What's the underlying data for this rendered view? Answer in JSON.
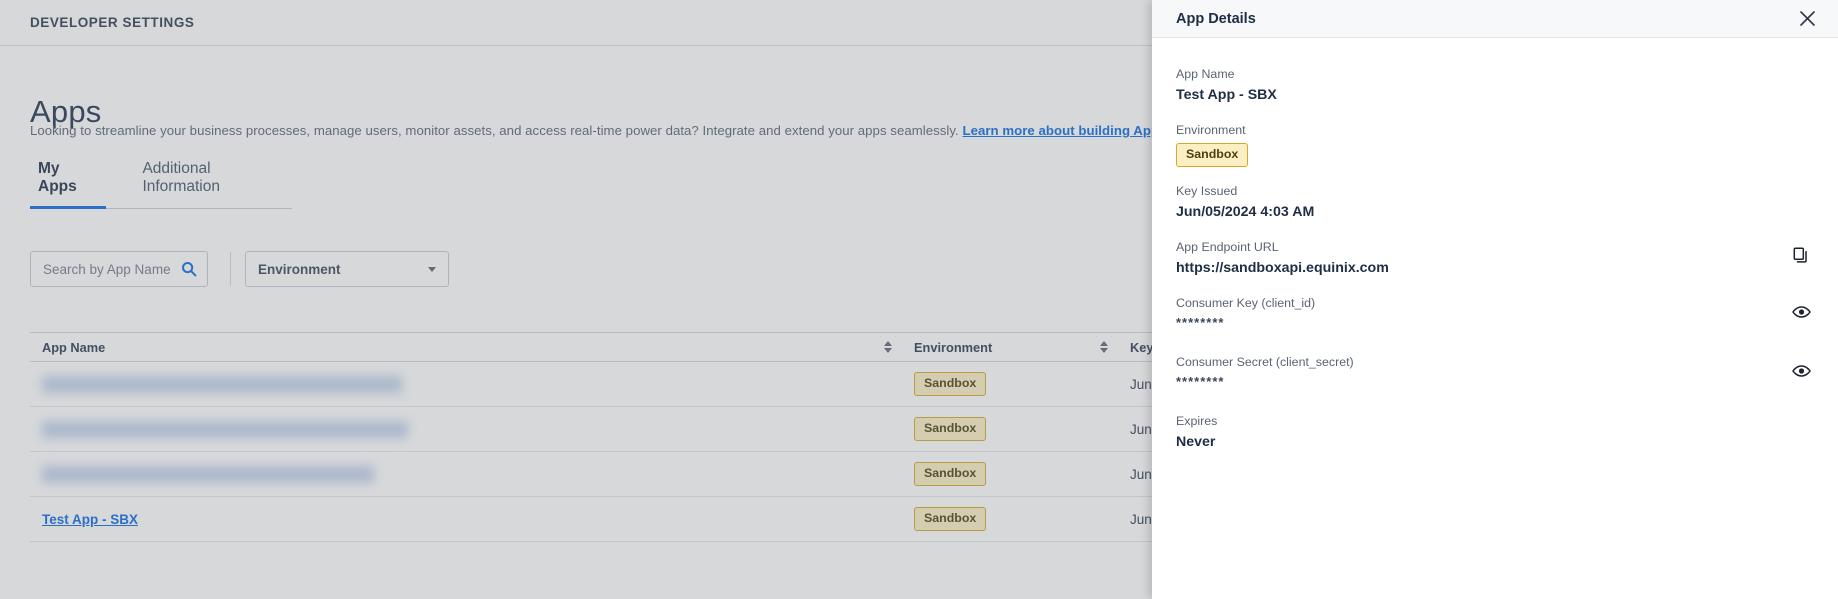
{
  "header": {
    "title": "DEVELOPER SETTINGS"
  },
  "main": {
    "page_title": "Apps",
    "description": "Looking to streamline your business processes, manage users, monitor assets, and access real-time power data? Integrate and extend your apps seamlessly.",
    "description_link": "Learn more about building Apps.",
    "tabs": [
      {
        "label": "My Apps",
        "active": true
      },
      {
        "label": "Additional Information",
        "active": false
      }
    ],
    "search": {
      "placeholder": "Search by App Name",
      "value": "",
      "icon": "search-icon"
    },
    "environment_filter": {
      "label": "Environment",
      "icon": "chevron-down-icon"
    }
  },
  "table": {
    "columns": [
      {
        "key": "app_name",
        "label": "App Name",
        "sortable": true
      },
      {
        "key": "environment",
        "label": "Environment",
        "sortable": true
      },
      {
        "key": "key_issued",
        "label": "Key",
        "sortable": false
      }
    ],
    "rows": [
      {
        "app_name": "",
        "redacted": true,
        "environment": "Sandbox",
        "key_issued": "Jun"
      },
      {
        "app_name": "",
        "redacted": true,
        "environment": "Sandbox",
        "key_issued": "Jun"
      },
      {
        "app_name": "",
        "redacted": true,
        "environment": "Sandbox",
        "key_issued": "Jun"
      },
      {
        "app_name": "Test App - SBX",
        "redacted": false,
        "environment": "Sandbox",
        "key_issued": "Jun"
      }
    ]
  },
  "panel": {
    "title": "App Details",
    "close_icon": "close-icon",
    "fields": [
      {
        "label": "App Name",
        "value": "Test App - SBX",
        "type": "text"
      },
      {
        "label": "Environment",
        "value": "Sandbox",
        "type": "badge"
      },
      {
        "label": "Key Issued",
        "value": "Jun/05/2024 4:03 AM",
        "type": "text"
      },
      {
        "label": "App Endpoint URL",
        "value": "https://sandboxapi.equinix.com",
        "type": "text",
        "action": "copy-icon"
      },
      {
        "label": "Consumer Key (client_id)",
        "value": "********",
        "type": "mask",
        "action": "eye-icon"
      },
      {
        "label": "Consumer Secret (client_secret)",
        "value": "********",
        "type": "mask",
        "action": "eye-icon"
      },
      {
        "label": "Expires",
        "value": "Never",
        "type": "text"
      }
    ]
  },
  "colors": {
    "link": "#0b6ae3",
    "badge_bg": "#fcefc3",
    "badge_border": "#d3a92b",
    "badge_text": "#4c3f12",
    "heading": "#1f2d45",
    "overlay": "rgba(120,125,132,0.30)"
  }
}
